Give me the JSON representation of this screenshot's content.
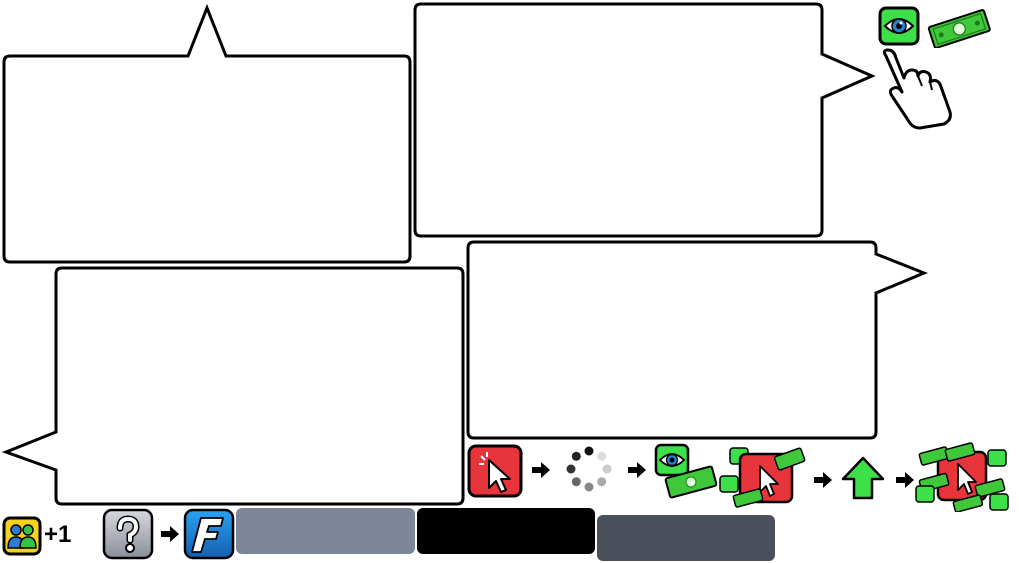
{
  "users_bonus": {
    "count_text": "+1",
    "icon": "users-icon"
  },
  "icons": {
    "help": "question-mark-icon",
    "f_logo": "f-logo-icon",
    "eye": "eye-icon",
    "money": "money-bill-icon",
    "hand": "pointing-hand-icon",
    "click": "cursor-click-icon",
    "spinner": "loading-spinner-icon",
    "arrow": "arrow-right-icon",
    "up": "green-up-arrow-icon"
  },
  "colors": {
    "bar_gray": "#7e8599",
    "bar_black": "#000000",
    "bar_dark": "#4a4f5c",
    "accent_red": "#e8343b",
    "accent_green": "#3ee04a",
    "money_green": "#3fc93a",
    "f_blue": "#1f84d6"
  }
}
